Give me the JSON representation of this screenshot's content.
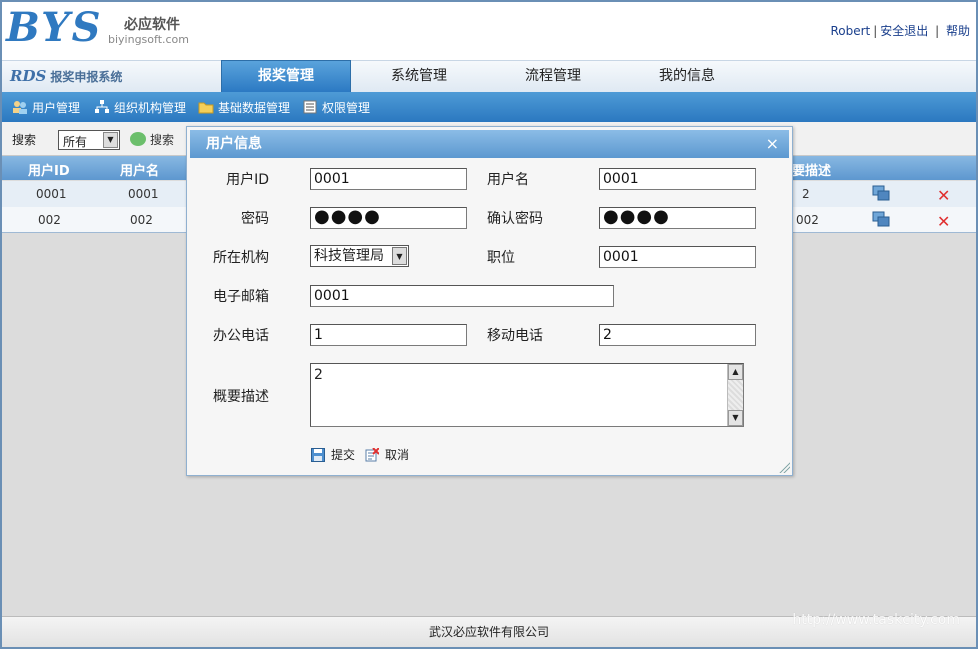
{
  "header": {
    "logo_text": "BYS",
    "logo_cn": "必应软件",
    "logo_url": "biyingsoft.com",
    "user": "Robert",
    "logout": "安全退出",
    "help": "帮助"
  },
  "nav": {
    "system_prefix": "RDS",
    "system_title": "报奖申报系统",
    "tabs": [
      {
        "label": "报奖管理",
        "active": true
      },
      {
        "label": "系统管理"
      },
      {
        "label": "流程管理"
      },
      {
        "label": "我的信息"
      }
    ]
  },
  "submenu": {
    "items": [
      {
        "label": "用户管理",
        "icon": "users-icon"
      },
      {
        "label": "组织机构管理",
        "icon": "org-tree-icon"
      },
      {
        "label": "基础数据管理",
        "icon": "folder-icon"
      },
      {
        "label": "权限管理",
        "icon": "list-icon"
      }
    ]
  },
  "search": {
    "label": "搜索",
    "select_value": "所有",
    "button": "搜索"
  },
  "table": {
    "columns": [
      "用户ID",
      "用户名",
      "要描述"
    ],
    "rows": [
      {
        "id": "0001",
        "name": "0001",
        "desc": "2"
      },
      {
        "id": "002",
        "name": "002",
        "desc": "002"
      }
    ]
  },
  "modal": {
    "title": "用户信息",
    "close": "×",
    "fields": {
      "user_id_label": "用户ID",
      "user_id_value": "0001",
      "username_label": "用户名",
      "username_value": "0001",
      "password_label": "密码",
      "password_value": "●●●●",
      "confirm_label": "确认密码",
      "confirm_value": "●●●●",
      "org_label": "所在机构",
      "org_value": "科技管理局",
      "position_label": "职位",
      "position_value": "0001",
      "email_label": "电子邮箱",
      "email_value": "0001",
      "office_phone_label": "办公电话",
      "office_phone_value": "1",
      "mobile_label": "移动电话",
      "mobile_value": "2",
      "summary_label": "概要描述",
      "summary_value": "2"
    },
    "submit": "提交",
    "cancel": "取消"
  },
  "footer": {
    "company": "武汉必应软件有限公司",
    "watermark": "http://www.taskcity.com"
  },
  "colors": {
    "accent": "#2b78c0",
    "header_blue": "#5c98d0",
    "delete_red": "#e03030"
  }
}
